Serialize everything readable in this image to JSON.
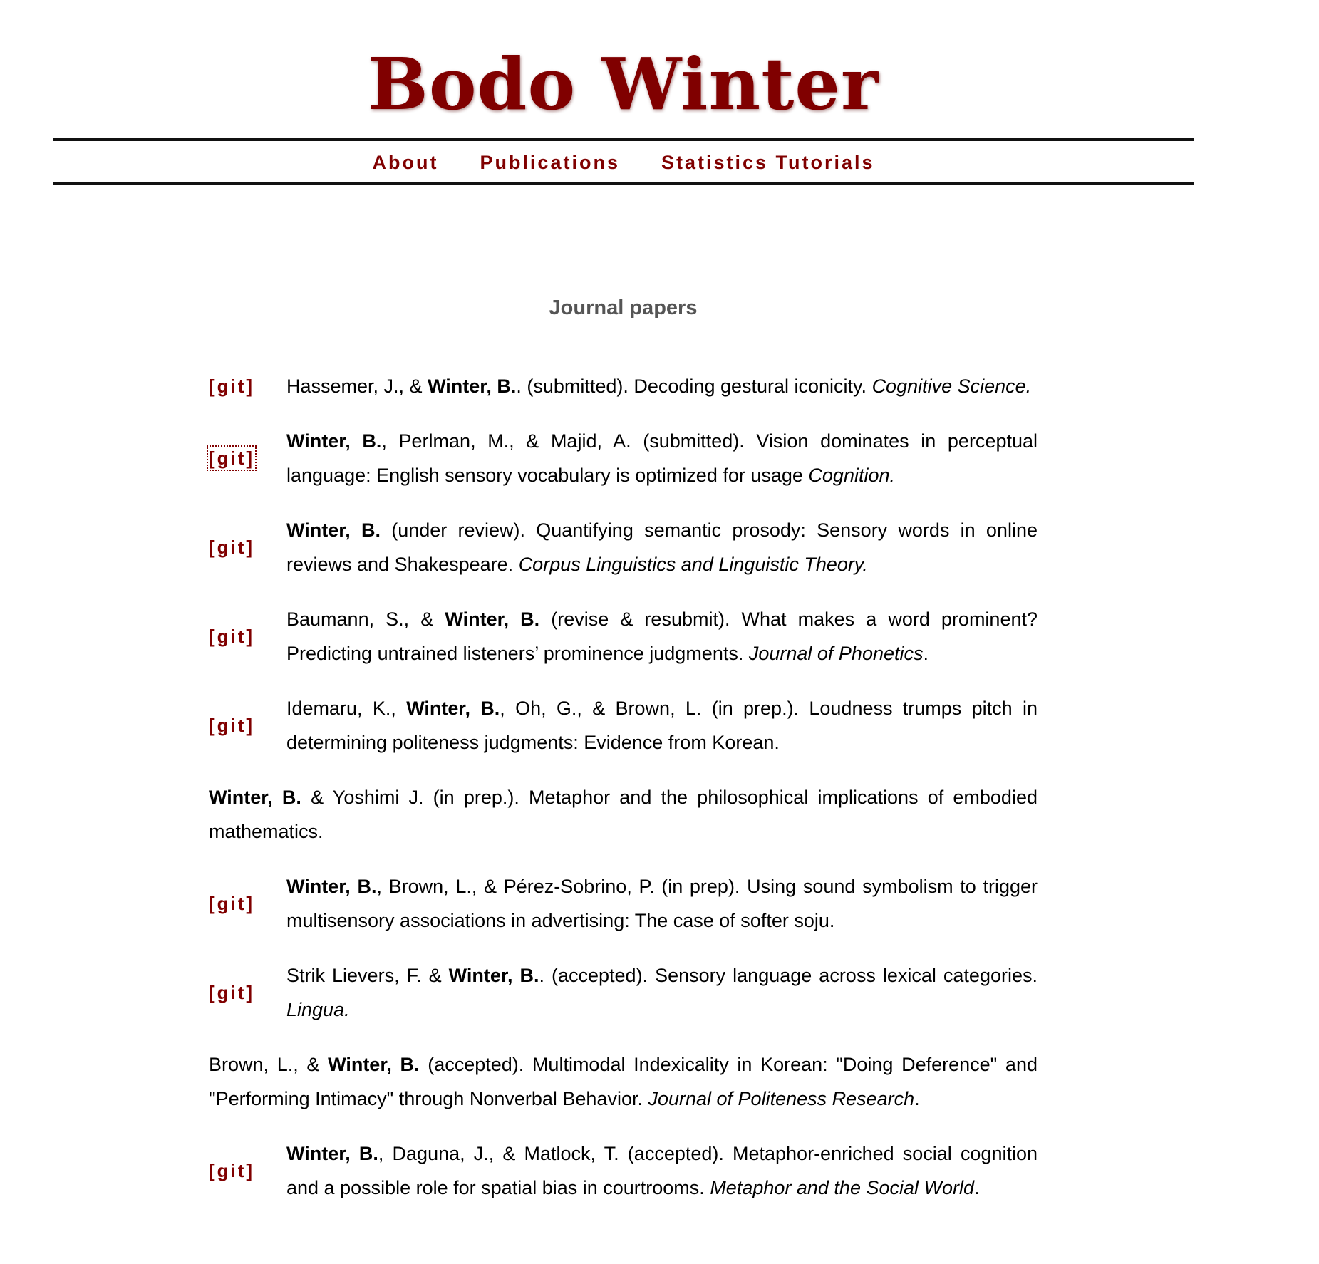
{
  "site": {
    "title": "Bodo Winter"
  },
  "nav": {
    "items": [
      "About",
      "Publications",
      "Statistics Tutorials"
    ]
  },
  "section": {
    "heading": "Journal papers"
  },
  "git_label": "[git]",
  "colors": {
    "brand": "#800000",
    "heading_gray": "#555555",
    "rule": "#111111"
  },
  "publications": [
    {
      "has_git": true,
      "focused": false,
      "parts": [
        {
          "s": "n",
          "t": "Hassemer, J., & "
        },
        {
          "s": "b",
          "t": "Winter, B."
        },
        {
          "s": "n",
          "t": ". (submitted). Decoding gestural iconicity. "
        },
        {
          "s": "i",
          "t": "Cognitive Science."
        }
      ]
    },
    {
      "has_git": true,
      "focused": true,
      "parts": [
        {
          "s": "b",
          "t": "Winter, B."
        },
        {
          "s": "n",
          "t": ", Perlman, M., & Majid, A. (submitted). Vision dominates in perceptual language: English sensory vocabulary is optimized for usage "
        },
        {
          "s": "i",
          "t": "Cognition."
        }
      ]
    },
    {
      "has_git": true,
      "focused": false,
      "parts": [
        {
          "s": "b",
          "t": "Winter, B."
        },
        {
          "s": "n",
          "t": " (under review). Quantifying semantic prosody: Sensory words in online reviews and Shakespeare. "
        },
        {
          "s": "i",
          "t": "Corpus Linguistics and Linguistic Theory."
        }
      ]
    },
    {
      "has_git": true,
      "focused": false,
      "parts": [
        {
          "s": "n",
          "t": "Baumann, S., & "
        },
        {
          "s": "b",
          "t": "Winter, B."
        },
        {
          "s": "n",
          "t": " (revise & resubmit). What makes a word prominent? Predicting untrained listeners’ prominence judgments. "
        },
        {
          "s": "i",
          "t": "Journal of Phonetics"
        },
        {
          "s": "n",
          "t": "."
        }
      ]
    },
    {
      "has_git": true,
      "focused": false,
      "parts": [
        {
          "s": "n",
          "t": "Idemaru, K., "
        },
        {
          "s": "b",
          "t": "Winter, B."
        },
        {
          "s": "n",
          "t": ", Oh, G., & Brown, L. (in prep.). Loudness trumps pitch in determining politeness judgments: Evidence from Korean."
        }
      ]
    },
    {
      "has_git": false,
      "focused": false,
      "parts": [
        {
          "s": "b",
          "t": "Winter, B."
        },
        {
          "s": "n",
          "t": " & Yoshimi J. (in prep.). Metaphor and the philosophical implications of embodied mathematics."
        }
      ]
    },
    {
      "has_git": true,
      "focused": false,
      "parts": [
        {
          "s": "b",
          "t": "Winter, B."
        },
        {
          "s": "n",
          "t": ", Brown, L., & Pérez-Sobrino, P. (in prep). Using sound symbolism to trigger multisensory associations in advertising: The case of softer soju."
        }
      ]
    },
    {
      "has_git": true,
      "focused": false,
      "parts": [
        {
          "s": "n",
          "t": "Strik Lievers, F. & "
        },
        {
          "s": "b",
          "t": "Winter, B."
        },
        {
          "s": "n",
          "t": ". (accepted). Sensory language across lexical categories. "
        },
        {
          "s": "i",
          "t": "Lingua."
        }
      ]
    },
    {
      "has_git": false,
      "focused": false,
      "parts": [
        {
          "s": "n",
          "t": "Brown, L., & "
        },
        {
          "s": "b",
          "t": "Winter, B."
        },
        {
          "s": "n",
          "t": " (accepted). Multimodal Indexicality in Korean: \"Doing Deference\" and \"Performing Intimacy\" through Nonverbal Behavior. "
        },
        {
          "s": "i",
          "t": "Journal of Politeness Research"
        },
        {
          "s": "n",
          "t": "."
        }
      ]
    },
    {
      "has_git": true,
      "focused": false,
      "parts": [
        {
          "s": "b",
          "t": "Winter, B."
        },
        {
          "s": "n",
          "t": ", Daguna, J., & Matlock, T. (accepted). Metaphor-enriched social cognition and a possible role for spatial bias in courtrooms. "
        },
        {
          "s": "i",
          "t": "Metaphor and the Social World"
        },
        {
          "s": "n",
          "t": "."
        }
      ]
    }
  ]
}
